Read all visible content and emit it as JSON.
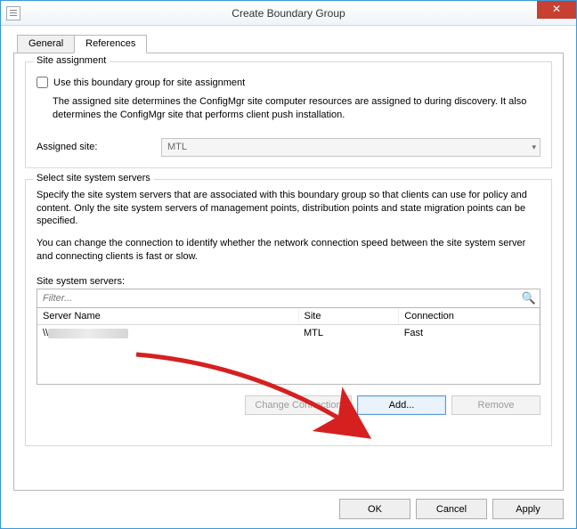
{
  "window": {
    "title": "Create Boundary Group",
    "close_icon": "✕"
  },
  "tabs": {
    "general": "General",
    "references": "References"
  },
  "site_assignment": {
    "group_title": "Site assignment",
    "checkbox_label": "Use this boundary group for site assignment",
    "description": "The assigned site determines the ConfigMgr site computer resources are assigned to during discovery. It also determines the ConfigMgr site that performs client push installation.",
    "assigned_site_label": "Assigned site:",
    "assigned_site_value": "MTL"
  },
  "servers": {
    "group_title": "Select site system servers",
    "description1": "Specify the site system servers that are associated with this boundary group so that clients can use for policy and content. Only the site system servers of management points, distribution points and state migration points can be specified.",
    "description2": "You can change the connection to identify whether the network connection speed between the site system server and connecting clients is fast or slow.",
    "list_label": "Site system servers:",
    "filter_placeholder": "Filter...",
    "columns": {
      "c1": "Server Name",
      "c2": "Site",
      "c3": "Connection"
    },
    "rows": [
      {
        "name": "\\\\",
        "site": "MTL",
        "connection": "Fast"
      }
    ],
    "buttons": {
      "change": "Change Connection",
      "add": "Add...",
      "remove": "Remove"
    }
  },
  "dialog_buttons": {
    "ok": "OK",
    "cancel": "Cancel",
    "apply": "Apply"
  }
}
